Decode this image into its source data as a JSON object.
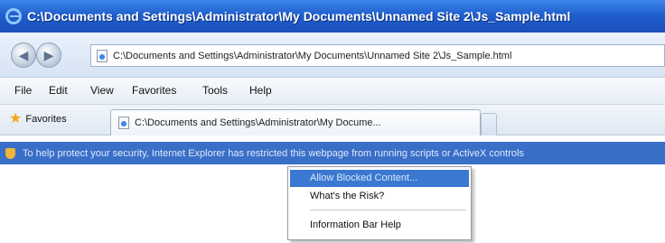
{
  "window": {
    "title": "C:\\Documents and Settings\\Administrator\\My Documents\\Unnamed Site 2\\Js_Sample.html"
  },
  "address_bar": {
    "url": "C:\\Documents and Settings\\Administrator\\My Documents\\Unnamed Site 2\\Js_Sample.html"
  },
  "menu_bar": {
    "items": [
      "File",
      "Edit",
      "View",
      "Favorites",
      "Tools",
      "Help"
    ]
  },
  "favorites_bar": {
    "favorites_label": "Favorites",
    "tab_title": "C:\\Documents and Settings\\Administrator\\My Docume..."
  },
  "information_bar": {
    "message": "To help protect your security, Internet Explorer has restricted this webpage from running scripts or ActiveX controls"
  },
  "context_menu": {
    "items": [
      {
        "label": "Allow Blocked Content...",
        "selected": true
      },
      {
        "label": "What's the Risk?",
        "selected": false
      },
      {
        "label": "Information Bar Help",
        "selected": false
      }
    ]
  },
  "colors": {
    "title_bar": "#1f5fcf",
    "info_bar": "#3a6fc8",
    "menu_highlight": "#3b78d2"
  }
}
